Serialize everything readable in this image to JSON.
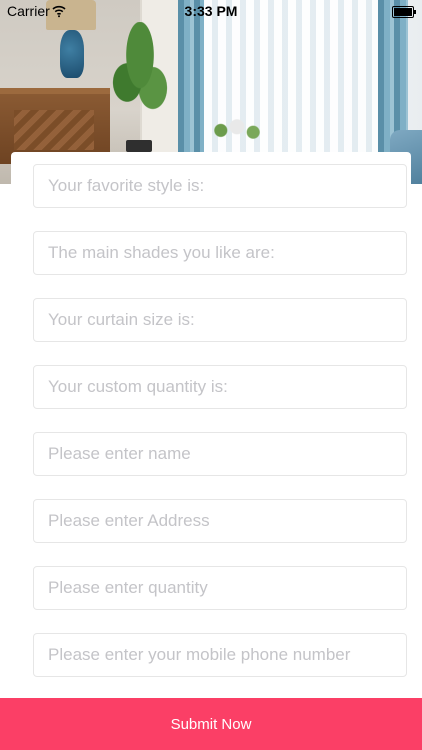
{
  "status_bar": {
    "carrier": "Carrier",
    "time": "3:33 PM"
  },
  "icons": {
    "wifi": "wifi-icon",
    "battery": "battery-icon"
  },
  "form": {
    "fields": [
      {
        "placeholder": "Your favorite style is:",
        "value": ""
      },
      {
        "placeholder": "The main shades you like are:",
        "value": ""
      },
      {
        "placeholder": "Your curtain size is:",
        "value": ""
      },
      {
        "placeholder": "Your custom quantity is:",
        "value": ""
      },
      {
        "placeholder": "Please enter name",
        "value": ""
      },
      {
        "placeholder": "Please enter Address",
        "value": ""
      },
      {
        "placeholder": "Please enter quantity",
        "value": ""
      },
      {
        "placeholder": "Please enter your mobile phone number",
        "value": ""
      }
    ]
  },
  "submit": {
    "label": "Submit Now"
  },
  "colors": {
    "accent": "#fb3f66",
    "field_border": "#e6e6e6",
    "placeholder": "#c4c4c8"
  }
}
